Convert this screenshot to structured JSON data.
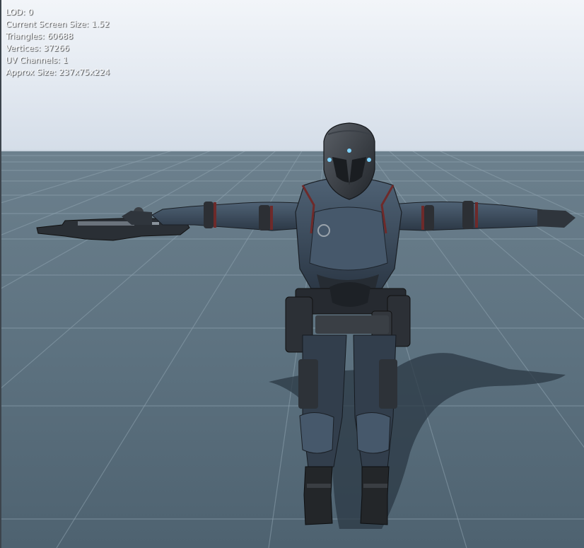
{
  "viewport": {
    "stats": [
      {
        "label": "LOD:",
        "value": "0"
      },
      {
        "label": "Current Screen Size:",
        "value": "1.52"
      },
      {
        "label": "Triangles:",
        "value": "60688"
      },
      {
        "label": "Vertices:",
        "value": "37266"
      },
      {
        "label": "UV Channels:",
        "value": "1"
      },
      {
        "label": "Approx Size:",
        "value": "237x75x224"
      }
    ]
  },
  "colors": {
    "sky_top": "#f2f5f9",
    "floor": "#5d7280",
    "floor_lines": "#8ea2ae",
    "armor": "#3a4a5c",
    "armor_dark": "#22282f",
    "visor_glow": "#7fd3ff"
  }
}
